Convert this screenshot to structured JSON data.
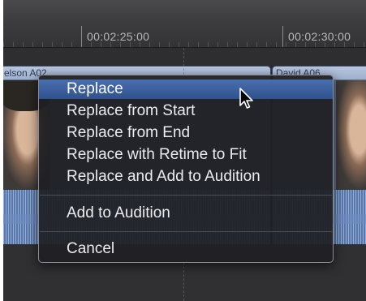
{
  "ruler": {
    "timecode_1": "00:02:25:00",
    "timecode_2": "00:02:30:00"
  },
  "clips": {
    "left_name": "elson A02",
    "right_name": "David A06"
  },
  "menu": {
    "items": [
      {
        "label": "Replace",
        "highlighted": true
      },
      {
        "label": "Replace from Start"
      },
      {
        "label": "Replace from End"
      },
      {
        "label": "Replace with Retime to Fit"
      },
      {
        "label": "Replace and Add to Audition"
      },
      {
        "label": "Add to Audition"
      },
      {
        "label": "Cancel"
      }
    ]
  },
  "colors": {
    "highlight": "#3a5f9e",
    "menu_bg": "#202024",
    "clip_header": "#a9b9d6",
    "waveform": "#5c77a6"
  },
  "icons": {
    "cursor": "arrow-pointer-icon"
  }
}
